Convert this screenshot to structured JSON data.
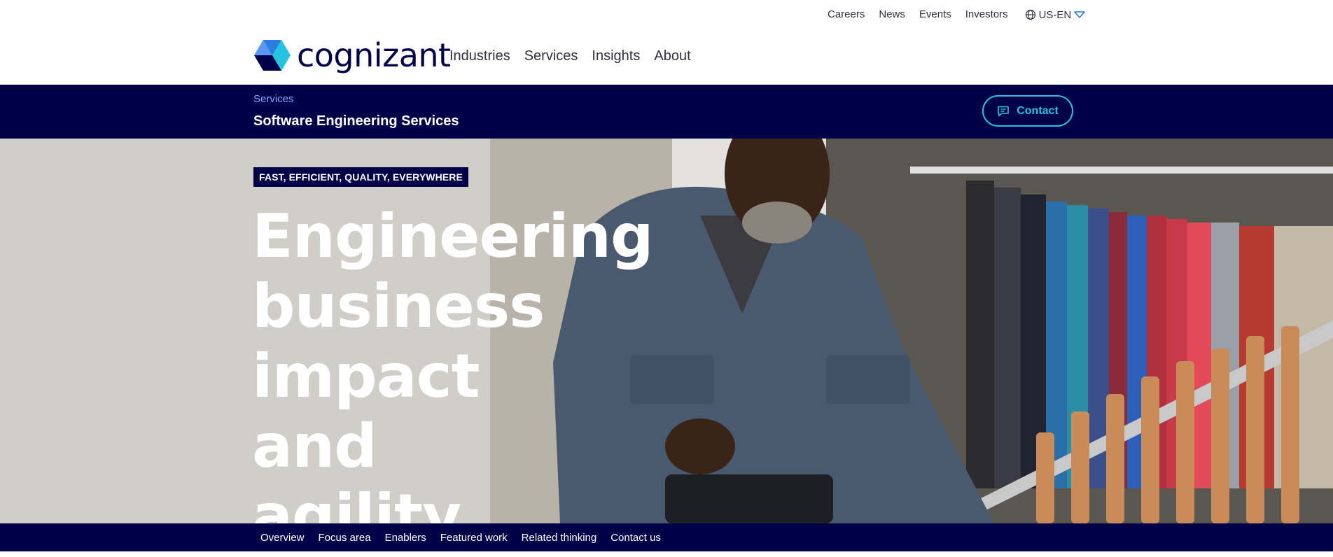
{
  "utility": {
    "links": [
      "Careers",
      "News",
      "Events",
      "Investors"
    ],
    "language": "US-EN"
  },
  "brand": {
    "name": "cognizant"
  },
  "nav": {
    "items": [
      "Industries",
      "Services",
      "Insights",
      "About"
    ]
  },
  "subheader": {
    "breadcrumb": "Services",
    "title": "Software Engineering Services",
    "contact_label": "Contact"
  },
  "hero": {
    "eyebrow": "FAST, EFFICIENT, QUALITY, EVERYWHERE",
    "headline_lines": [
      "Engineering",
      "business",
      "impact and",
      "agility"
    ]
  },
  "anchors": [
    "Overview",
    "Focus area",
    "Enablers",
    "Featured work",
    "Related thinking",
    "Contact us"
  ],
  "colors": {
    "navy": "#000048",
    "accent_cyan": "#26c3e0",
    "breadcrumb_blue": "#7fa8ff"
  }
}
